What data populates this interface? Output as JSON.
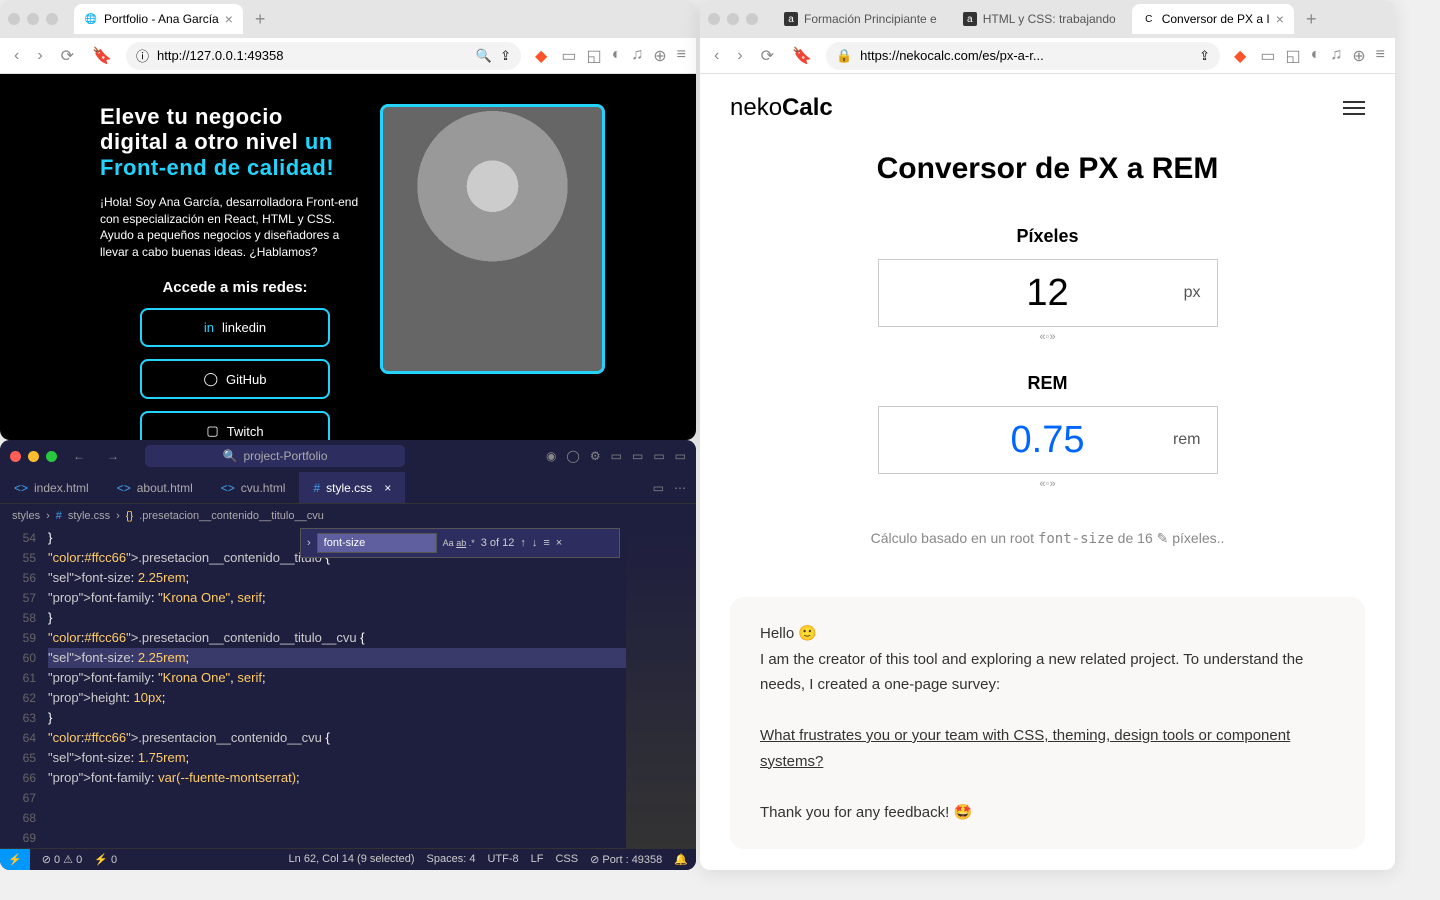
{
  "leftBrowser": {
    "tab": {
      "title": "Portfolio - Ana García"
    },
    "url": "http://127.0.0.1:49358",
    "portfolio": {
      "titleLine1": "Eleve tu negocio",
      "titleLine2": "digital a otro nivel ",
      "titleAccent": "un Front-end de calidad!",
      "desc": "¡Hola! Soy Ana García, desarrolladora Front-end con especialización en React, HTML y CSS. Ayudo a pequeños negocios y diseñadores a llevar a cabo buenas ideas. ¿Hablamos?",
      "redesTitle": "Accede a mis redes:",
      "buttons": [
        "linkedin",
        "GitHub",
        "Twitch"
      ]
    }
  },
  "rightBrowser": {
    "tabs": [
      {
        "title": "Formación Principiante e",
        "active": false
      },
      {
        "title": "HTML y CSS: trabajando",
        "active": false
      },
      {
        "title": "Conversor de PX a I",
        "active": true
      }
    ],
    "url": "https://nekocalc.com/es/px-a-r...",
    "logo1": "neko",
    "logo2": "Calc",
    "title": "Conversor de PX a REM",
    "pxLabel": "Píxeles",
    "pxValue": "12",
    "pxUnit": "px",
    "remLabel": "REM",
    "remValue": "0.75",
    "remUnit": "rem",
    "slider": "«◦»",
    "note1": "Cálculo basado en un root ",
    "noteCode": "font-size",
    "note2": " de ",
    "noteVal": "16",
    "note3": " píxeles..",
    "cardHello": "Hello 🙂",
    "cardP1": "I am the creator of this tool and exploring a new related project. To understand the needs, I created a one-page survey:",
    "cardLink": "What frustrates you or your team with CSS, theming, design tools or component systems?",
    "cardThanks": "Thank you for any feedback! 🤩"
  },
  "vscode": {
    "project": "project-Portfolio",
    "tabs": [
      "index.html",
      "about.html",
      "cvu.html",
      "style.css"
    ],
    "breadcrumb": [
      "styles",
      "style.css",
      ".presetacion__contenido__titulo__cvu"
    ],
    "find": {
      "value": "font-size",
      "count": "3 of 12"
    },
    "lines": [
      {
        "n": "54",
        "t": "}"
      },
      {
        "n": "55",
        "t": ""
      },
      {
        "n": "56",
        "t": ".presetacion__contenido__titulo {"
      },
      {
        "n": "57",
        "t": "    font-size: 2.25rem;",
        "hl": true
      },
      {
        "n": "58",
        "t": "    font-family: \"Krona One\", serif;"
      },
      {
        "n": "59",
        "t": "}"
      },
      {
        "n": "60",
        "t": ""
      },
      {
        "n": "61",
        "t": ".presetacion__contenido__titulo__cvu {"
      },
      {
        "n": "62",
        "t": "    font-size: 2.25rem;",
        "cur": true
      },
      {
        "n": "63",
        "t": "    font-family: \"Krona One\", serif;"
      },
      {
        "n": "64",
        "t": "    height: 10px;"
      },
      {
        "n": "65",
        "t": "}"
      },
      {
        "n": "66",
        "t": ""
      },
      {
        "n": "67",
        "t": ".presentacion__contenido__cvu {"
      },
      {
        "n": "68",
        "t": "    font-size: 1.75rem;",
        "hl": true
      },
      {
        "n": "69",
        "t": "    font-family: var(--fuente-montserrat);"
      }
    ],
    "status": {
      "errors": "⊘ 0 ⚠ 0",
      "port_ant": "⚡ 0",
      "cursor": "Ln 62, Col 14 (9 selected)",
      "spaces": "Spaces: 4",
      "encoding": "UTF-8",
      "eol": "LF",
      "lang": "CSS",
      "port": "⊘ Port : 49358"
    }
  }
}
